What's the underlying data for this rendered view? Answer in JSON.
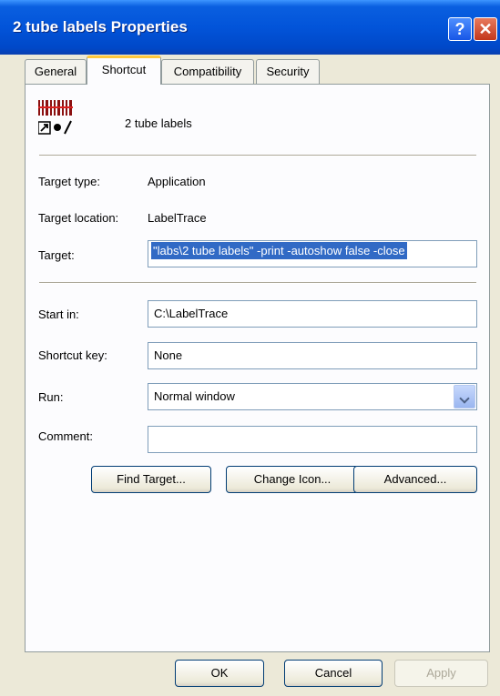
{
  "window": {
    "title": "2 tube labels Properties"
  },
  "tabs": [
    "General",
    "Shortcut",
    "Compatibility",
    "Security"
  ],
  "shortcut": {
    "name": "2 tube labels",
    "target_type_label": "Target type:",
    "target_type_value": "Application",
    "target_location_label": "Target location:",
    "target_location_value": "LabelTrace",
    "target_label": "Target:",
    "target_value": "\"labs\\2 tube labels\" -print -autoshow false -close",
    "start_in_label": "Start in:",
    "start_in_value": "C:\\LabelTrace",
    "shortcut_key_label": "Shortcut key:",
    "shortcut_key_value": "None",
    "run_label": "Run:",
    "run_value": "Normal window",
    "comment_label": "Comment:",
    "comment_value": ""
  },
  "buttons": {
    "find_target": "Find Target...",
    "change_icon": "Change Icon...",
    "advanced": "Advanced...",
    "ok": "OK",
    "cancel": "Cancel",
    "apply": "Apply"
  },
  "colors": {
    "title_bar": "#0254d9",
    "selection": "#316ac5",
    "tab_highlight": "#ffc83c"
  }
}
